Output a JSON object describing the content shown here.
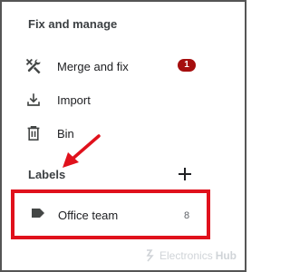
{
  "fix_manage": {
    "title": "Fix and manage",
    "items": [
      {
        "label": "Merge and fix",
        "icon": "merge-fix-icon",
        "badge": "1"
      },
      {
        "label": "Import",
        "icon": "import-icon"
      },
      {
        "label": "Bin",
        "icon": "trash-icon"
      }
    ]
  },
  "labels": {
    "title": "Labels",
    "add_icon": "plus-icon",
    "items": [
      {
        "label": "Office team",
        "count": "8",
        "icon": "label-tag-icon"
      }
    ]
  },
  "watermark": {
    "part1": "Electronics",
    "part2": "Hub"
  },
  "colors": {
    "badge": "#a50e0e",
    "annotation_red": "#e0111c",
    "text": "#202124",
    "icon": "#444746"
  }
}
